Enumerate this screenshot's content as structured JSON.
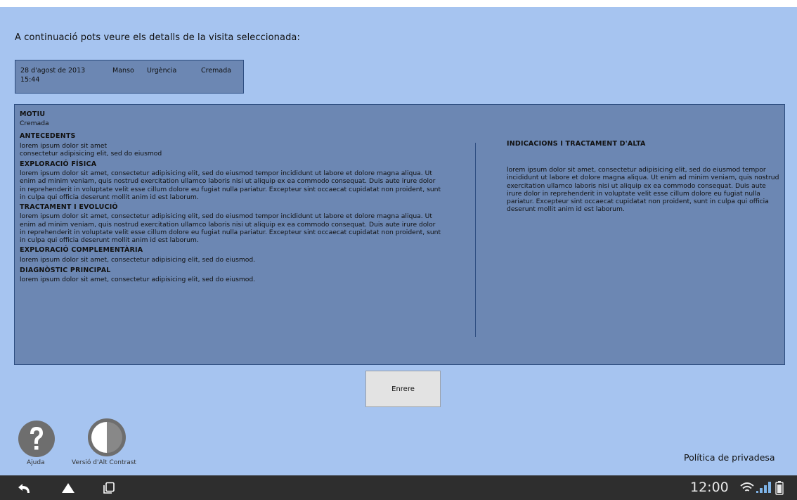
{
  "page_title": "A continuació pots veure els detalls de la visita seleccionada:",
  "visit": {
    "date": "28 d'agost de 2013",
    "time": "15:44",
    "doctor": "Manso",
    "type": "Urgència",
    "reason": "Cremada"
  },
  "details": {
    "motiu": {
      "heading": "MOTIU",
      "text": "Cremada"
    },
    "antecedents": {
      "heading": "ANTECEDENTS",
      "line1": "lorem ipsum dolor sit amet",
      "line2": "consectetur adipisicing elit, sed do eiusmod"
    },
    "exploracio_fisica": {
      "heading": "EXPLORACIÓ FÍSICA",
      "text": "lorem ipsum dolor sit amet, consectetur adipisicing elit, sed do eiusmod tempor incididunt ut labore et dolore magna aliqua. Ut enim ad minim veniam, quis nostrud exercitation ullamco laboris nisi ut aliquip ex ea commodo consequat. Duis aute irure dolor in reprehenderit in voluptate velit esse cillum dolore eu fugiat nulla pariatur. Excepteur sint occaecat cupidatat non proident, sunt in culpa qui officia deserunt mollit anim id est laborum."
    },
    "tractament_evolucio": {
      "heading": "TRACTAMENT I EVOLUCIÓ",
      "text": "lorem ipsum dolor sit amet, consectetur adipisicing elit, sed do eiusmod tempor incididunt ut labore et dolore magna aliqua. Ut enim ad minim veniam, quis nostrud exercitation ullamco laboris nisi ut aliquip ex ea commodo consequat. Duis aute irure dolor in reprehenderit in voluptate velit esse cillum dolore eu fugiat nulla pariatur. Excepteur sint occaecat cupidatat non proident, sunt in culpa qui officia deserunt mollit anim id est laborum."
    },
    "exploracio_complementaria": {
      "heading": "EXPLORACIÓ COMPLEMENTÀRIA",
      "text": "lorem ipsum dolor sit amet, consectetur adipisicing elit, sed do eiusmod."
    },
    "diagnostic_principal": {
      "heading": "DIAGNÒSTIC PRINCIPAL",
      "text": "lorem ipsum dolor sit amet, consectetur adipisicing elit, sed do eiusmod."
    },
    "indicacions": {
      "heading": "INDICACIONS I TRACTAMENT D'ALTA",
      "text": "lorem ipsum dolor sit amet, consectetur adipisicing elit, sed do eiusmod tempor incididunt ut labore et dolore magna aliqua. Ut enim ad minim veniam, quis nostrud exercitation ullamco laboris nisi ut aliquip ex ea commodo consequat. Duis aute irure dolor in reprehenderit in voluptate velit esse cillum dolore eu fugiat nulla pariatur. Excepteur sint occaecat cupidatat non proident, sunt in culpa qui officia deserunt mollit anim id est laborum."
    }
  },
  "back_button": "Enrere",
  "footer": {
    "help_label": "Ajuda",
    "help_icon": "help-question-icon",
    "contrast_label": "Versió d'Alt Contrast",
    "contrast_icon": "contrast-icon",
    "privacy_label": "Política de privadesa"
  },
  "system_bar": {
    "clock": "12:00",
    "icons": [
      "back-icon",
      "home-icon",
      "recent-apps-icon",
      "wifi-icon",
      "signal-icon",
      "battery-icon"
    ]
  },
  "colors": {
    "background": "#a6c4f0",
    "panel": "#6c87b3",
    "panel_border": "#2d4d80",
    "button": "#e3e3e3",
    "system_bar": "#2e2e2e"
  }
}
